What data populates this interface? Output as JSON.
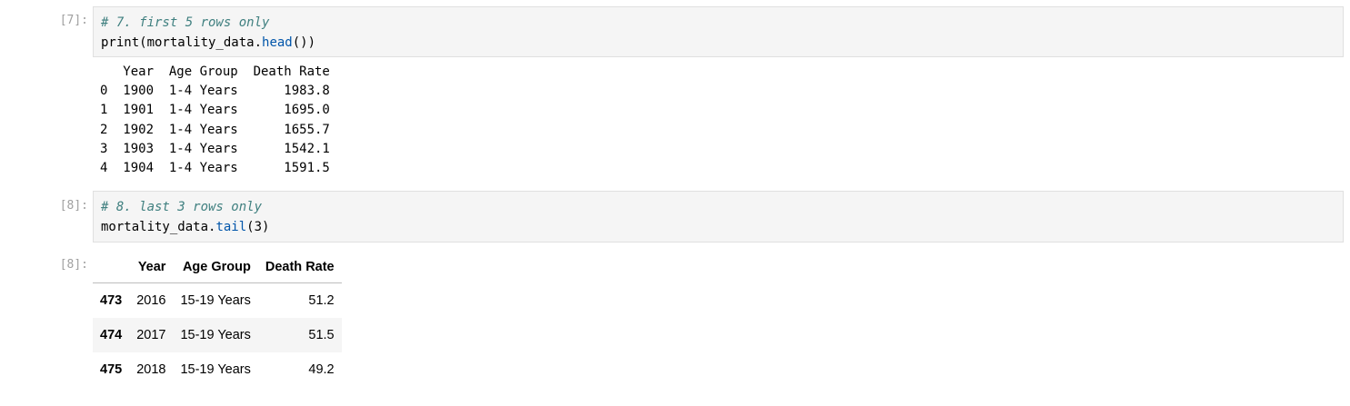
{
  "cells": [
    {
      "prompt": "[7]:",
      "code": [
        "# 7. first 5 rows only",
        "print(mortality_data.",
        "head",
        "())"
      ],
      "output_text": [
        "   Year  Age Group  Death Rate",
        "0  1900  1-4 Years      1983.8",
        "1  1901  1-4 Years      1695.0",
        "2  1902  1-4 Years      1655.7",
        "3  1903  1-4 Years      1542.1",
        "4  1904  1-4 Years      1591.5"
      ]
    },
    {
      "prompt": "[8]:",
      "code": [
        "# 8. last 3 rows only",
        "mortality_data.",
        "tail",
        "(3)"
      ],
      "output_prompt": "[8]:",
      "table": {
        "columns": [
          "Year",
          "Age Group",
          "Death Rate"
        ],
        "rows": [
          {
            "index": "473",
            "year": "2016",
            "age_group": "15-19 Years",
            "death_rate": "51.2"
          },
          {
            "index": "474",
            "year": "2017",
            "age_group": "15-19 Years",
            "death_rate": "51.5"
          },
          {
            "index": "475",
            "year": "2018",
            "age_group": "15-19 Years",
            "death_rate": "49.2"
          }
        ]
      }
    }
  ],
  "colors": {
    "comment": "#408080",
    "attribute": "#0055aa",
    "prompt": "#a0a0a0",
    "cell_bg": "#f5f5f5"
  }
}
